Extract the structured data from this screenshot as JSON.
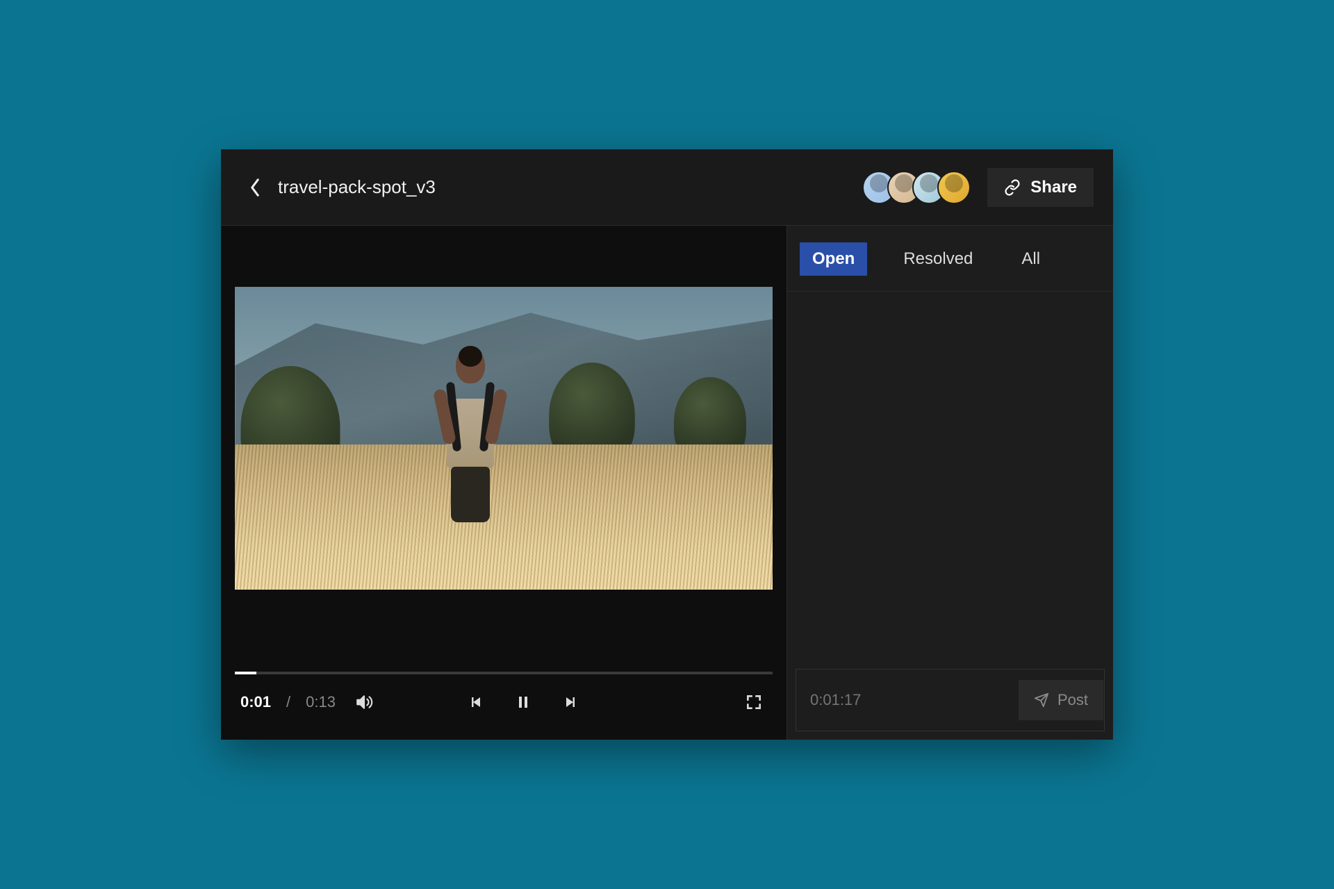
{
  "header": {
    "title": "travel-pack-spot_v3",
    "share_label": "Share",
    "collaborator_count": 4
  },
  "player": {
    "current_time": "0:01",
    "duration": "0:13",
    "progress_pct": 4
  },
  "comments": {
    "tabs": {
      "open": "Open",
      "resolved": "Resolved",
      "all": "All"
    },
    "active_tab": "open",
    "compose_placeholder": "0:01:17",
    "post_label": "Post"
  }
}
